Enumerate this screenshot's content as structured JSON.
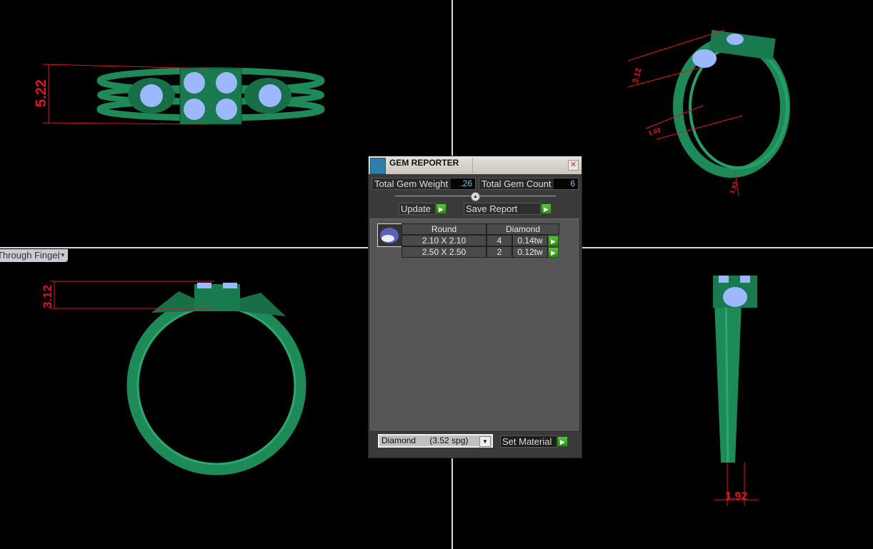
{
  "viewports": {
    "top_left": {
      "dimension": "5.22"
    },
    "top_right": {
      "dimensions": [
        "3.12",
        "1.92",
        "1.92"
      ]
    },
    "bottom_left": {
      "dimension": "3.12",
      "view_mode": "Through Finger"
    },
    "bottom_right": {
      "dimension": "1.92"
    }
  },
  "dialog": {
    "title": "GEM REPORTER",
    "close_icon": "close-icon",
    "total_gem_weight_label": "Total Gem Weight",
    "total_gem_weight": ".26",
    "total_gem_count_label": "Total Gem Count",
    "total_gem_count": "6",
    "update_label": "Update",
    "save_report_label": "Save Report",
    "table": {
      "shape": "Round",
      "material": "Diamond",
      "rows": [
        {
          "size": "2.10 X 2.10",
          "count": "4",
          "weight": "0.14tw"
        },
        {
          "size": "2.50 X 2.50",
          "count": "2",
          "weight": "0.12tw"
        }
      ]
    },
    "material_select": {
      "name": "Diamond",
      "spg": "(3.52 spg)"
    },
    "set_material_label": "Set Material"
  },
  "colors": {
    "metal": "#1f8a5a",
    "gem": "#9cb8ff",
    "dimension": "#e0141c"
  }
}
